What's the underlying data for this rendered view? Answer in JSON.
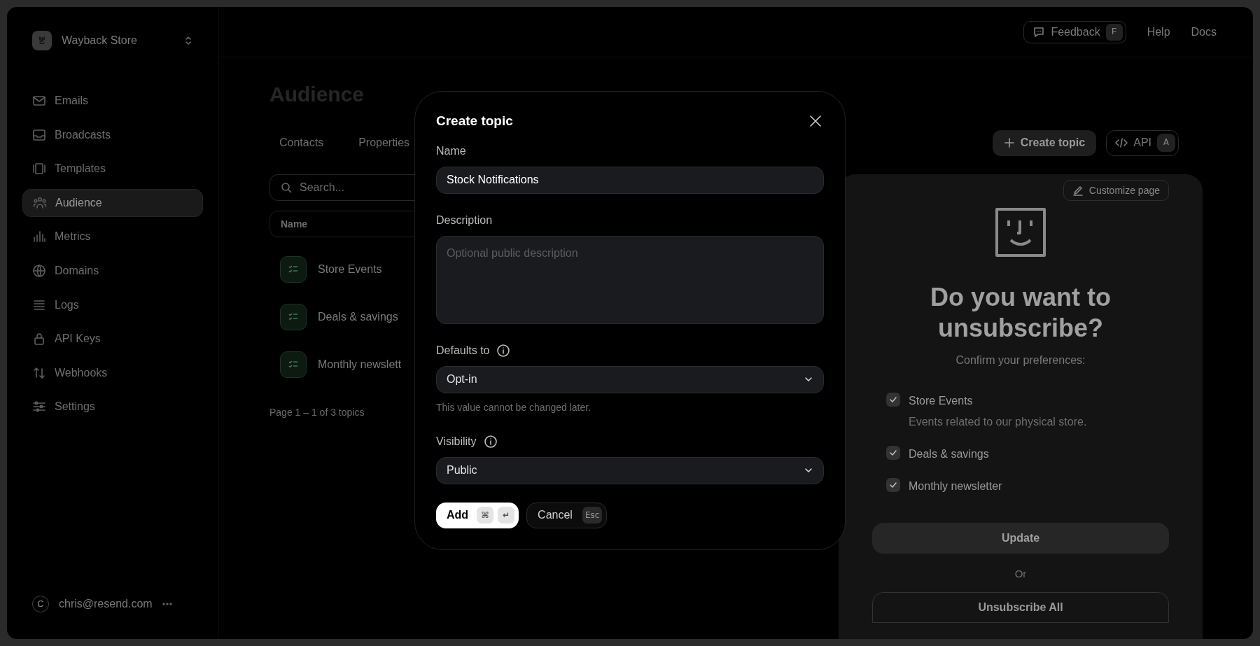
{
  "sidebar": {
    "workspace": "Wayback Store",
    "items": [
      {
        "label": "Emails",
        "selected": false
      },
      {
        "label": "Broadcasts",
        "selected": false
      },
      {
        "label": "Templates",
        "selected": false
      },
      {
        "label": "Audience",
        "selected": true
      },
      {
        "label": "Metrics",
        "selected": false
      },
      {
        "label": "Domains",
        "selected": false
      },
      {
        "label": "Logs",
        "selected": false
      },
      {
        "label": "API Keys",
        "selected": false
      },
      {
        "label": "Webhooks",
        "selected": false
      },
      {
        "label": "Settings",
        "selected": false
      }
    ],
    "user": {
      "avatar": "C",
      "email": "chris@resend.com"
    }
  },
  "topbar": {
    "feedback": {
      "label": "Feedback",
      "shortcut": "F"
    },
    "links": [
      "Help",
      "Docs"
    ]
  },
  "page": {
    "title": "Audience",
    "tabs": [
      {
        "label": "Contacts",
        "selected": false
      },
      {
        "label": "Properties",
        "selected": false
      }
    ],
    "actions": [
      {
        "kind": "primary",
        "label": "Create topic"
      },
      {
        "kind": "secondary",
        "label": "API",
        "shortcut": "A"
      }
    ],
    "search": {
      "placeholder": "Search..."
    },
    "table": {
      "columns": [
        "Name"
      ],
      "rows": [
        "Store Events",
        "Deals & savings",
        "Monthly newslett"
      ]
    },
    "pagination": "Page 1 – 1 of 3 topics"
  },
  "preview": {
    "customize": "Customize page",
    "heading": "Do you want to unsubscribe?",
    "subheading": "Confirm your preferences:",
    "topics": [
      {
        "name": "Store Events",
        "description": "Events related to our physical store.",
        "checked": true
      },
      {
        "name": "Deals & savings",
        "checked": true
      },
      {
        "name": "Monthly newsletter",
        "checked": true
      }
    ],
    "update": "Update",
    "or": "Or",
    "unsubscribe": "Unsubscribe All"
  },
  "modal": {
    "title": "Create topic",
    "fields": [
      {
        "kind": "text",
        "label": "Name",
        "value": "Stock Notifications"
      },
      {
        "kind": "textarea",
        "label": "Description",
        "placeholder": "Optional public description"
      },
      {
        "kind": "select",
        "label": "Defaults to",
        "info": true,
        "value": "Opt-in",
        "hint": "This value cannot be changed later."
      },
      {
        "kind": "select",
        "label": "Visibility",
        "info": true,
        "value": "Public"
      }
    ],
    "buttons": [
      {
        "kind": "primary",
        "label": "Add",
        "keys": [
          "⌘",
          "↵"
        ]
      },
      {
        "kind": "secondary",
        "label": "Cancel",
        "keys": [
          "Esc"
        ]
      }
    ]
  }
}
